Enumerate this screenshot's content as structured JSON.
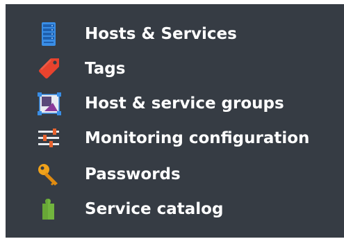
{
  "sidebar": {
    "items": [
      {
        "label": "Hosts & Services",
        "icon": "server-icon"
      },
      {
        "label": "Tags",
        "icon": "tag-icon"
      },
      {
        "label": "Host & service groups",
        "icon": "groups-icon"
      },
      {
        "label": "Monitoring configuration",
        "icon": "sliders-icon"
      },
      {
        "label": "Passwords",
        "icon": "key-icon"
      },
      {
        "label": "Service catalog",
        "icon": "puzzle-icon"
      }
    ]
  },
  "colors": {
    "background": "#363c44",
    "text": "#ffffff",
    "server_blue": "#3a8ee6",
    "tag_red": "#e8432e",
    "slider_orange": "#e8632e",
    "key_orange": "#f0a21b",
    "puzzle_green": "#72b53e"
  }
}
